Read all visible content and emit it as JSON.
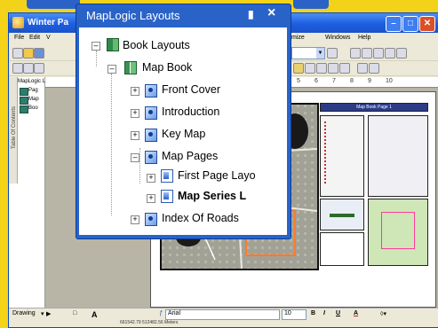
{
  "app": {
    "title": "Winter Pa",
    "colors": {
      "titlebar": "#1d5ee0",
      "background_accent": "#f5d316",
      "close_button": "#d9502a"
    }
  },
  "menubar": {
    "items": [
      "File",
      "Edit",
      "V",
      "mize",
      "Windows",
      "Help"
    ]
  },
  "toc": {
    "tab_label": "Table Of Contents",
    "header": "MapLogic La",
    "rows": [
      "Pag",
      "Map",
      "Boo"
    ]
  },
  "ruler": {
    "ticks": [
      "5",
      "6",
      "7",
      "8",
      "9",
      "10"
    ]
  },
  "panel": {
    "title": "MapLogic Layouts",
    "pin_icon": "pin-icon",
    "close_icon": "close-icon",
    "tree": {
      "root": "Book Layouts",
      "book": "Map Book",
      "items": [
        "Front Cover",
        "Introduction",
        "Key Map",
        "Map Pages",
        "Index Of Roads"
      ],
      "map_pages_children": [
        "First Page Layo",
        "Map Series L"
      ]
    }
  },
  "drawbar": {
    "drawing_label": "Drawing",
    "text_tool": "A",
    "font_name": "Arial",
    "font_size": "10",
    "bold": "B",
    "italic": "I",
    "underline": "U",
    "font_color": "A"
  },
  "status": {
    "coordinates": "661542.79  512482.56 Meters"
  },
  "map_page": {
    "header_text": "Map Book Page 1"
  }
}
